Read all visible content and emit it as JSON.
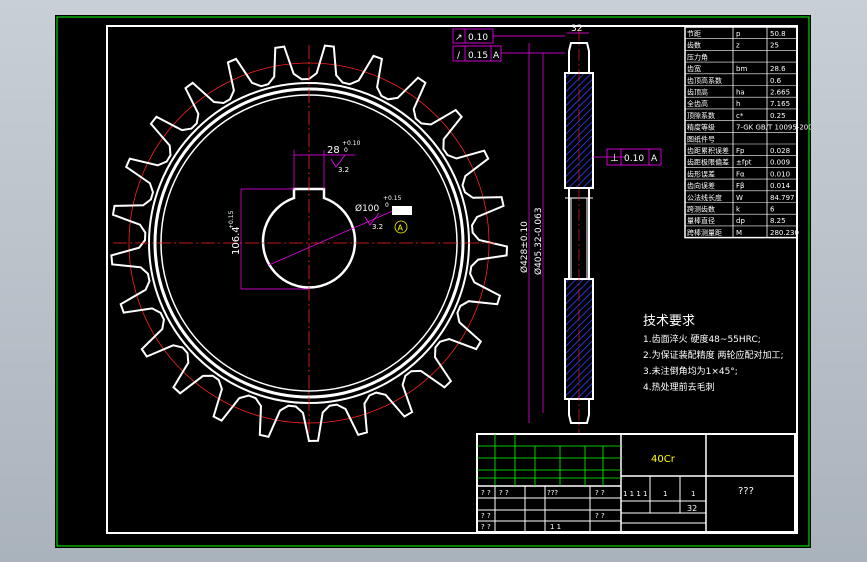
{
  "colors": {
    "background": "#000000",
    "frame": "#ffffff",
    "border": "#00ff00",
    "center_line": "#ff0000",
    "dimension": "#ff00ff",
    "hatch": "#3040ff",
    "table_text": "#ffffff"
  },
  "drawing": {
    "teeth": 25
  },
  "front_view": {
    "dim_key_width": "28",
    "dim_key_width_tol_upper": "+0.10",
    "dim_key_width_tol_lower": "0",
    "dim_key_depth": "106.4",
    "dim_key_depth_tol": "+0.15",
    "dim_bore": "Ø100",
    "dim_bore_tol_upper": "+0.15",
    "dim_bore_tol_lower": "0",
    "roughness_1": "3.2",
    "roughness_2": "3.2",
    "datum_label": "A"
  },
  "side_view": {
    "gdt_1_symbol": "↗",
    "gdt_1_value": "0.10",
    "gdt_2_symbol": "/",
    "gdt_2_value": "0.15",
    "gdt_2_datum": "A",
    "gdt_3_symbol": "⊥",
    "gdt_3_value": "0.10",
    "gdt_3_datum": "A",
    "dim_width": "32",
    "dim_diam_1": "Ø428±0.10",
    "dim_diam_2": "Ø405.32-0.063"
  },
  "param_table": {
    "rows": [
      {
        "label": "节距",
        "symbol": "p",
        "value": "50.8"
      },
      {
        "label": "齿数",
        "symbol": "z",
        "value": "25"
      },
      {
        "label": "压力角",
        "symbol": "",
        "value": ""
      },
      {
        "label": "齿宽",
        "symbol": "bm",
        "value": "28.6"
      },
      {
        "label": "齿顶高系数",
        "symbol": "",
        "value": "0.6"
      },
      {
        "label": "齿顶高",
        "symbol": "ha",
        "value": "2.665"
      },
      {
        "label": "全齿高",
        "symbol": "h",
        "value": "7.165"
      },
      {
        "label": "顶隙系数",
        "symbol": "c*",
        "value": "0.25"
      },
      {
        "label": "精度等级",
        "symbol": "7-GK GB/T 10095-200",
        "value": ""
      },
      {
        "label": "图纸件号",
        "symbol": "",
        "value": ""
      },
      {
        "label": "齿距累积误差",
        "symbol": "Fp",
        "value": "0.028"
      },
      {
        "label": "齿距极限偏差",
        "symbol": "±fpt",
        "value": "0.009"
      },
      {
        "label": "齿形误差",
        "symbol": "Fα",
        "value": "0.010"
      },
      {
        "label": "齿向误差",
        "symbol": "Fβ",
        "value": "0.014"
      },
      {
        "label": "公法线长度",
        "symbol": "W",
        "value": "84.797"
      },
      {
        "label": "跨测齿数",
        "symbol": "k",
        "value": "6"
      },
      {
        "label": "量棒直径",
        "symbol": "dp",
        "value": "8.25"
      },
      {
        "label": "跨棒测量距",
        "symbol": "M",
        "value": "280.230"
      }
    ]
  },
  "notes": {
    "title": "技术要求",
    "items": [
      "1.齿面淬火  硬度48~55HRC;",
      "2.为保证装配精度  两轮应配对加工;",
      "3.未注倒角均为1×45°;",
      "4.热处理前去毛刺"
    ]
  },
  "title_block": {
    "material": "40Cr",
    "drawing_name": "???",
    "q1": "? ?",
    "q2": "? ?",
    "q3": "???",
    "q4": "? ?",
    "q5": "? ?",
    "q6": "? ?",
    "q7": "? ?",
    "q8": "1 1",
    "scale_cells": "1 1 1 1",
    "c1": "1",
    "c2": "1",
    "sheet_no": "32"
  }
}
